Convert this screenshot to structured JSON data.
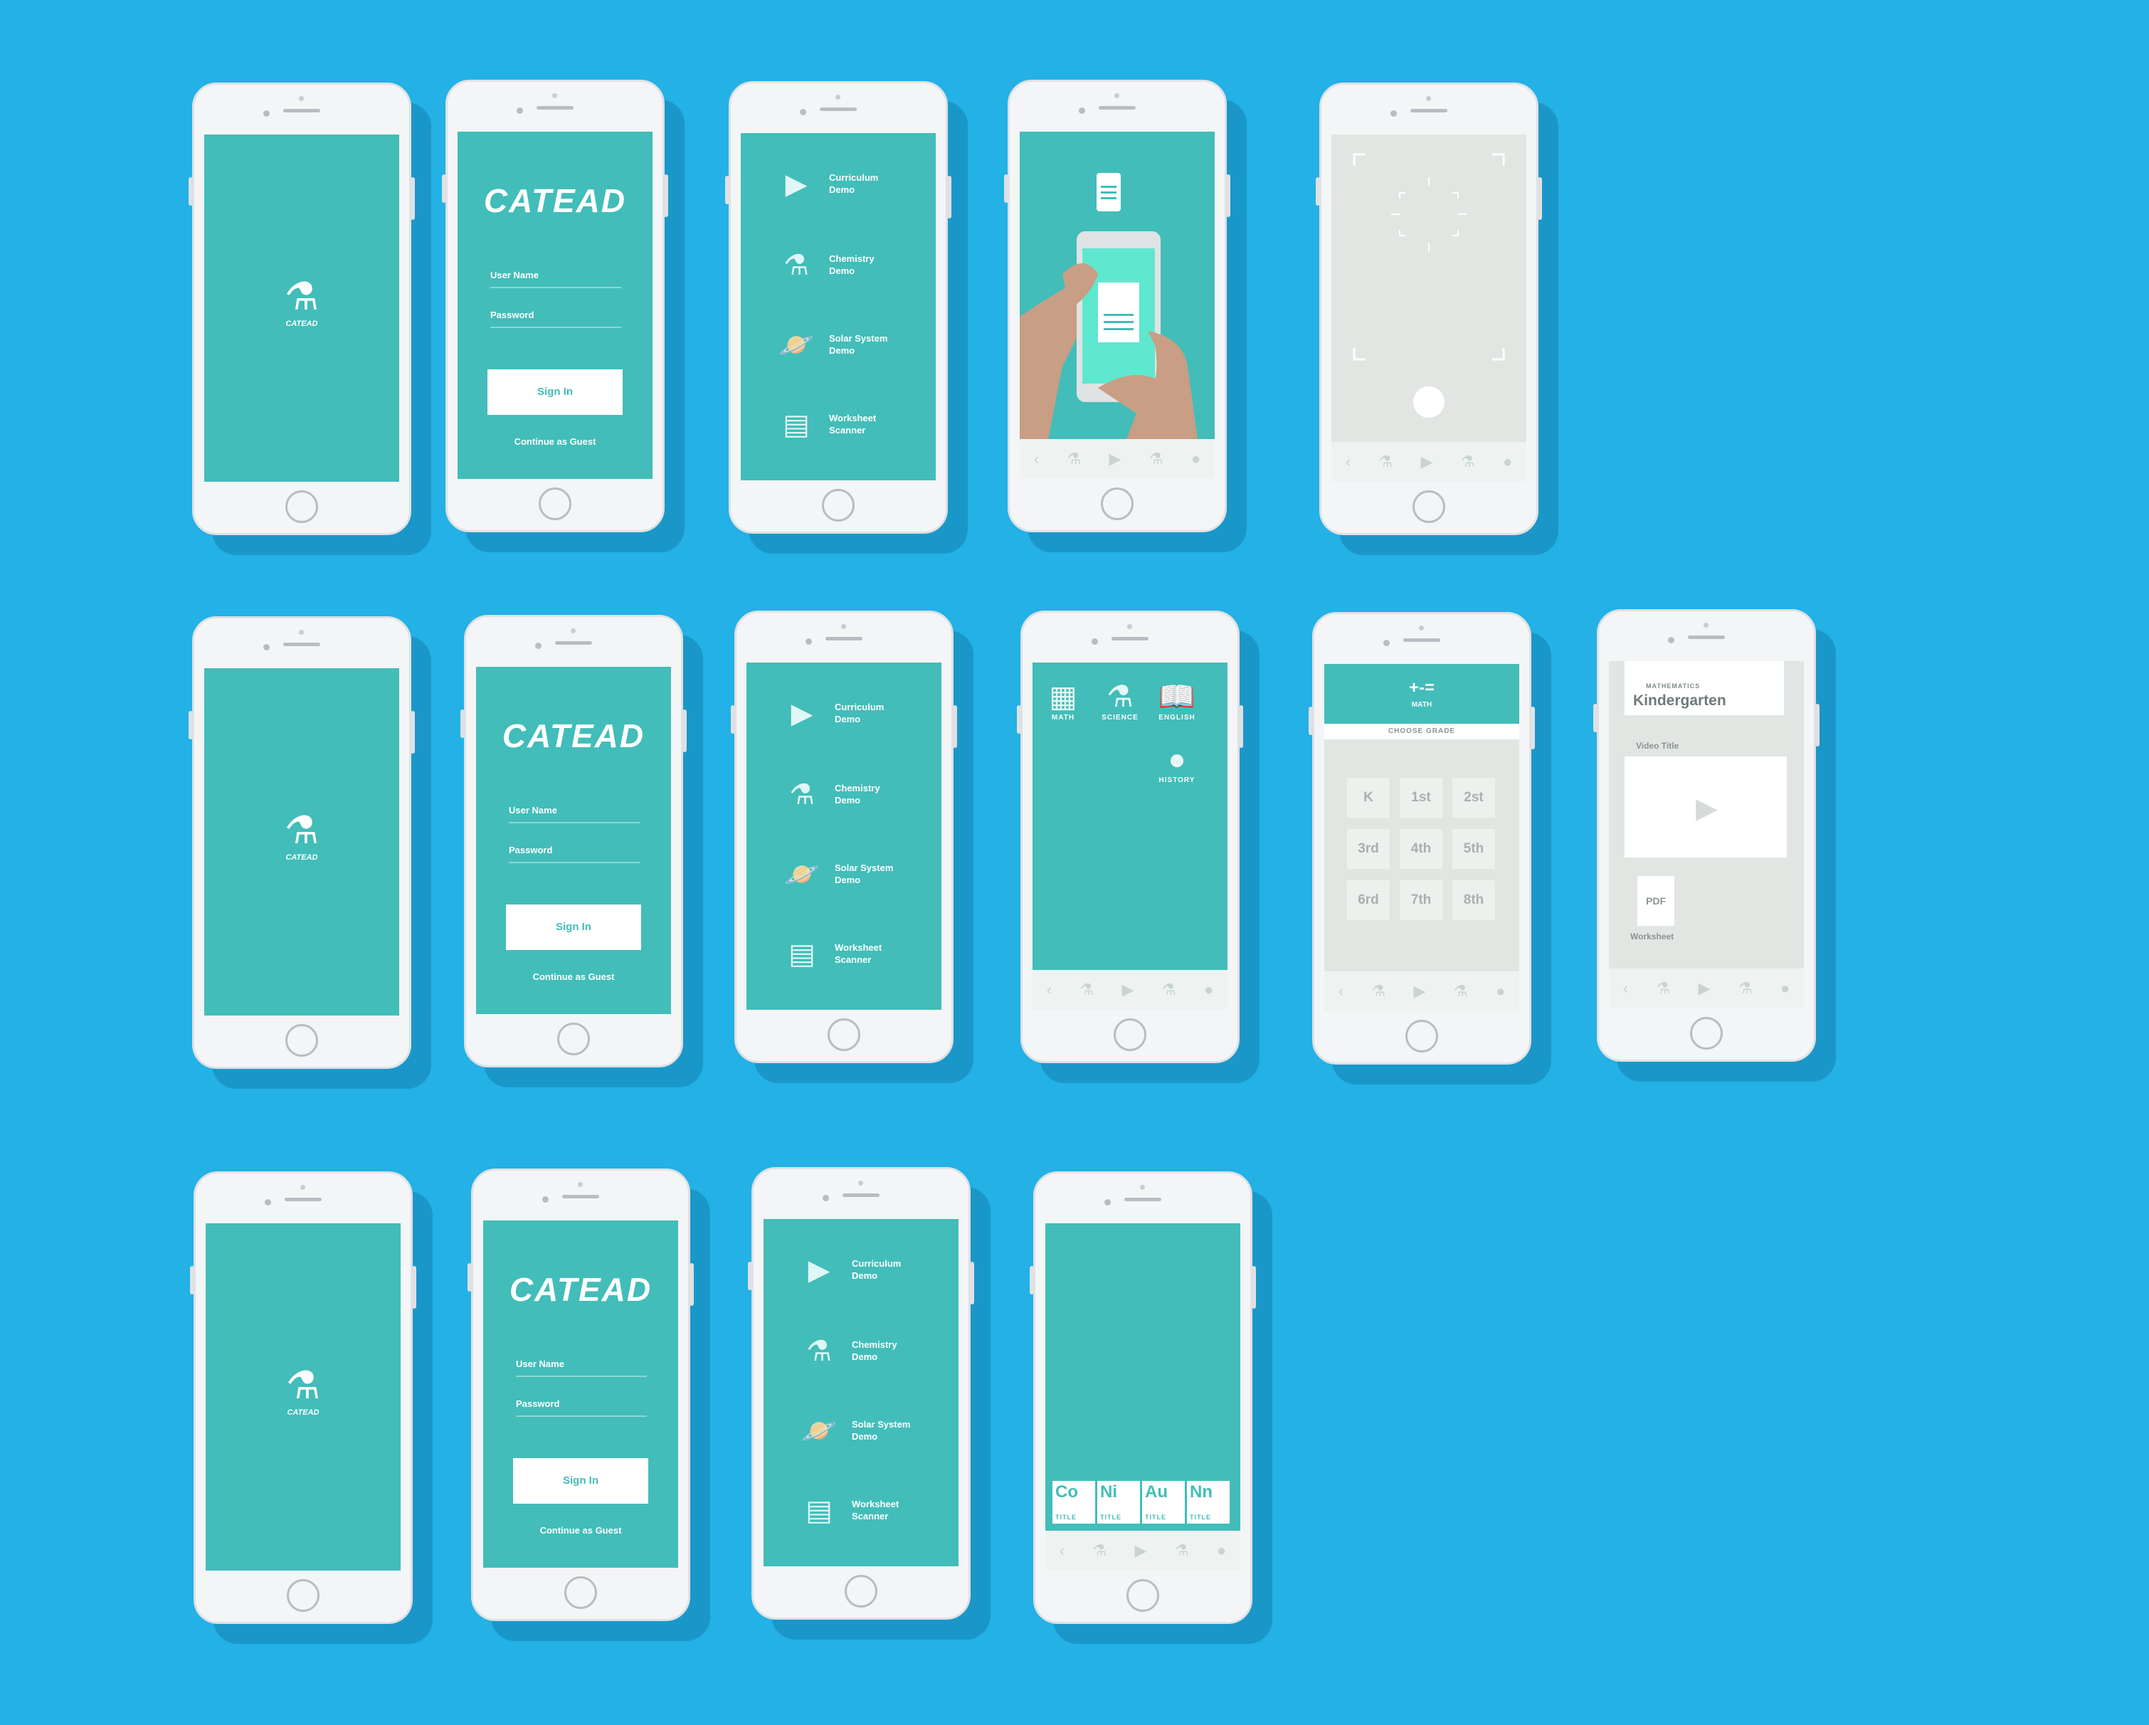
{
  "brand": {
    "logo_text": "CATEAD",
    "splash_logo_text": "CATEAD"
  },
  "login": {
    "username_label": "User Name",
    "password_label": "Password",
    "signin_label": "Sign In",
    "guest_label": "Continue as Guest"
  },
  "menu": {
    "curriculum": "Curriculum\nDemo",
    "chemistry": "Chemistry\nDemo",
    "solar": "Solar System\nDemo",
    "worksheet": "Worksheet\nScanner"
  },
  "subjects": {
    "math": "MATH",
    "science": "SCIENCE",
    "english": "ENGLISH",
    "history": "HISTORY"
  },
  "grades": {
    "header_symbols": "+-=",
    "header_subject": "MATH",
    "choose_label": "CHOOSE GRADE",
    "items": [
      "K",
      "1st",
      "2st",
      "3rd",
      "4th",
      "5th",
      "6rd",
      "7th",
      "8th"
    ]
  },
  "lesson": {
    "subject": "MATHEMATICS",
    "title": "Kindergarten",
    "video_title": "Video Title",
    "pdf_label": "PDF",
    "worksheet_label": "Worksheet"
  },
  "elements": {
    "title_label": "TITLE",
    "items": [
      {
        "symbol": "Co"
      },
      {
        "symbol": "Ni"
      },
      {
        "symbol": "Au"
      },
      {
        "symbol": "Nn"
      }
    ]
  },
  "colors": {
    "background": "#23b1e6",
    "screen": "#42bdb9",
    "phone": "#f4f5f6"
  }
}
